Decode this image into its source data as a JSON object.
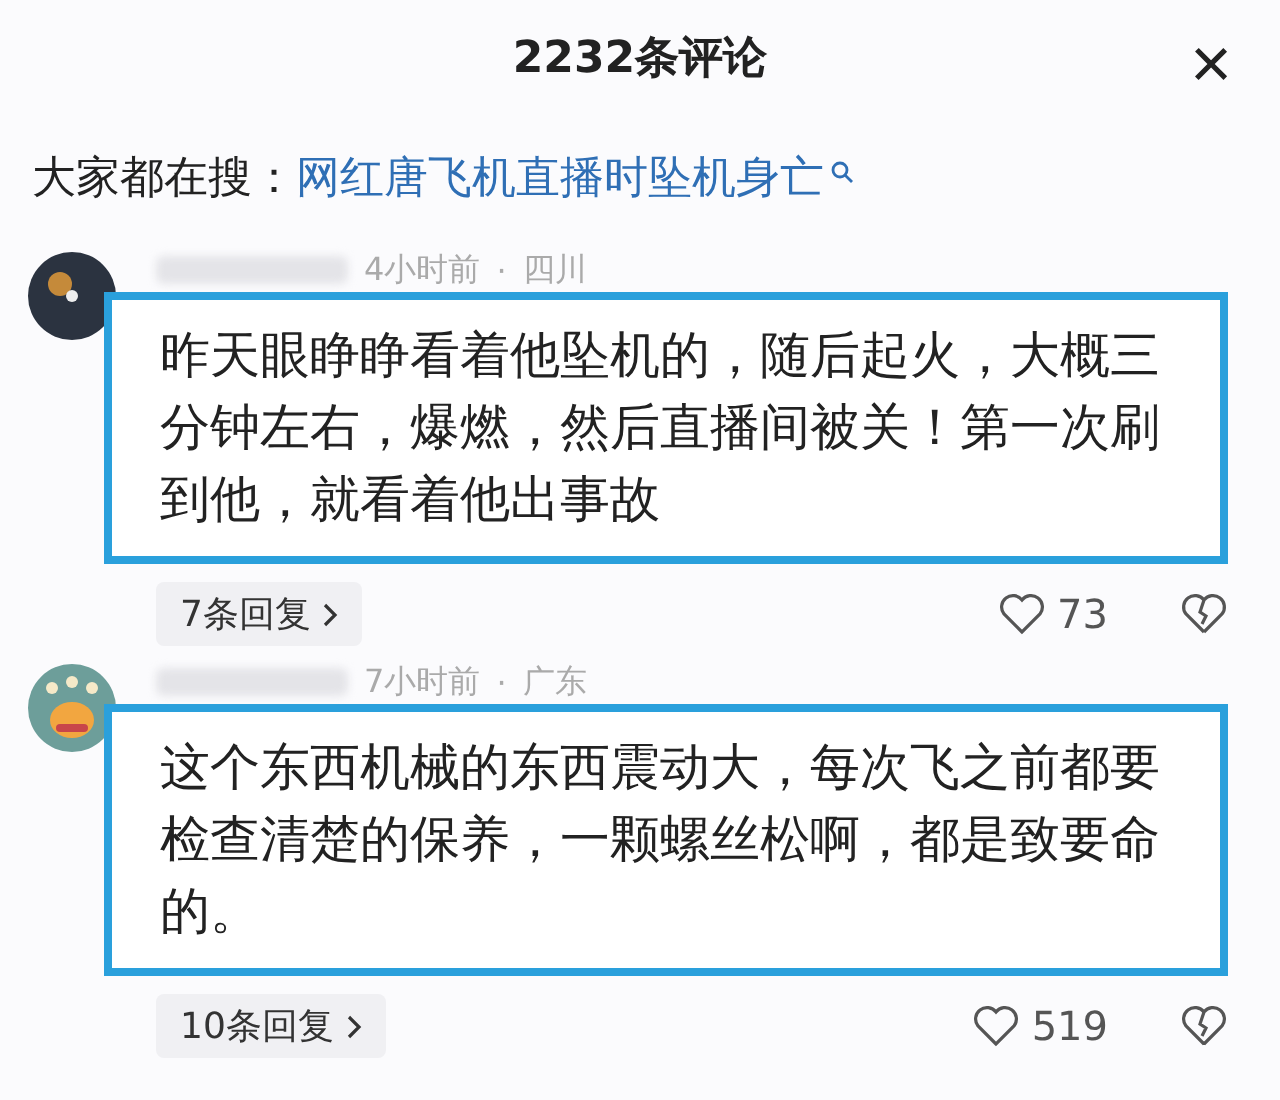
{
  "header": {
    "title": "2232条评论",
    "close": "×"
  },
  "trending": {
    "label": "大家都在搜：",
    "query": "网红唐飞机直播时坠机身亡"
  },
  "comments": [
    {
      "time": "4小时前",
      "separator": "·",
      "location": "四川",
      "text": "昨天眼睁睁看着他坠机的，随后起火，大概三分钟左右，爆燃，然后直播间被关！第一次刷到他，就看着他出事故",
      "replies": "7条回复",
      "likes": "73"
    },
    {
      "time": "7小时前",
      "separator": "·",
      "location": "广东",
      "text": "这个东西机械的东西震动大，每次飞之前都要检查清楚的保养，一颗螺丝松啊，都是致要命的。",
      "replies": "10条回复",
      "likes": "519"
    }
  ]
}
